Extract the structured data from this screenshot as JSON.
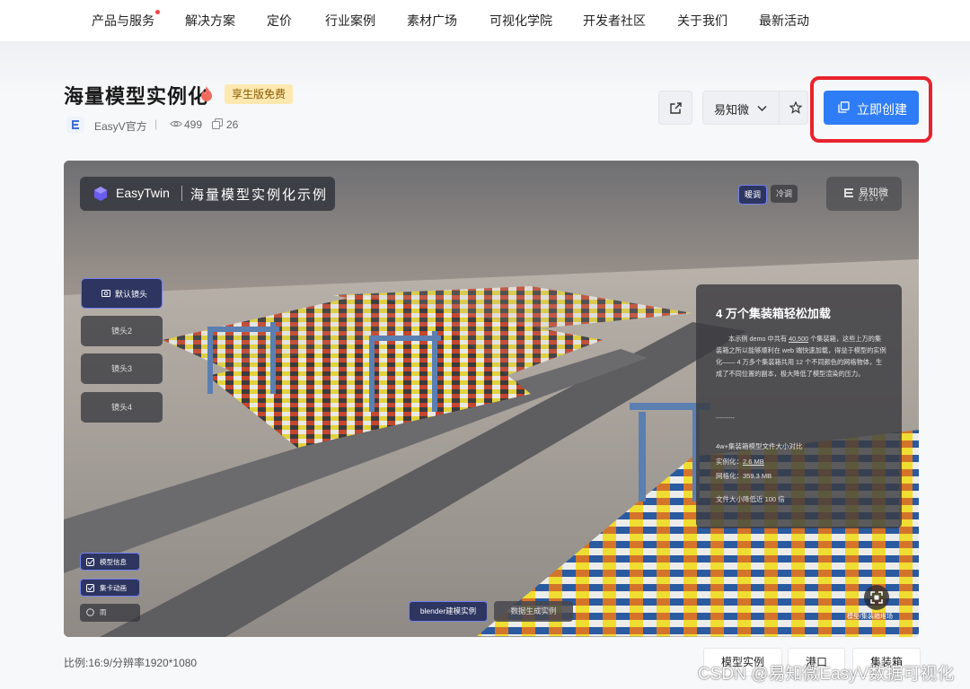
{
  "nav": {
    "items": [
      "产品与服务",
      "解决方案",
      "定价",
      "行业案例",
      "素材广场",
      "可视化学院",
      "开发者社区",
      "关于我们",
      "最新活动"
    ]
  },
  "template": {
    "title": "海量模型实例化",
    "badge": "享生版免费",
    "author": "EasyV官方",
    "views": "499",
    "copies": "26"
  },
  "actions": {
    "brand_select": "易知微",
    "create_label": "立即创建"
  },
  "preview": {
    "app_name": "EasyTwin",
    "scene_title": "海量模型实例化示例",
    "theme_warm": "暖调",
    "theme_cool": "冷调",
    "logo_cn": "易知微",
    "logo_en": "EASYV",
    "cameras": [
      "默认镜头",
      "镜头2",
      "镜头3",
      "镜头4"
    ],
    "panel": {
      "heading": "4 万个集装箱轻松加载",
      "body_before": "本示例 demo 中共有 ",
      "body_count": "40,500",
      "body_after": " 个集装箱，这些上万的集装箱之所以能够顺利在 web 端快速加载，得益于模型的实例化—— 4 万多个集装箱共用 12 个不同颜色的网格物体，生成了不同位置的副本，极大降低了模型渲染的压力。",
      "divider": "---------",
      "compare_title": "4w+集装箱模型文件大小对比",
      "instance_label": "实例化：",
      "instance_value": "2.6 MB",
      "mesh_label": "网格化：",
      "mesh_value": "359.3 MB",
      "summary": "文件大小降低近 100 倍"
    },
    "toggles": [
      "模型信息",
      "集卡动画",
      "雨"
    ],
    "tabs": [
      "blender建模实例",
      "数据生成实例"
    ],
    "model_tree_label": "模型/集装箱堆场"
  },
  "footer": {
    "ratio": "比例:16:9/分辨率1920*1080",
    "tags": [
      "模型实例",
      "港口",
      "集装箱"
    ],
    "watermark": "CSDN @易知微EasyV数据可视化"
  },
  "colors": {
    "primary": "#2f7df6",
    "highlight_border": "#e8232d",
    "badge_bg": "#fde9b0"
  }
}
